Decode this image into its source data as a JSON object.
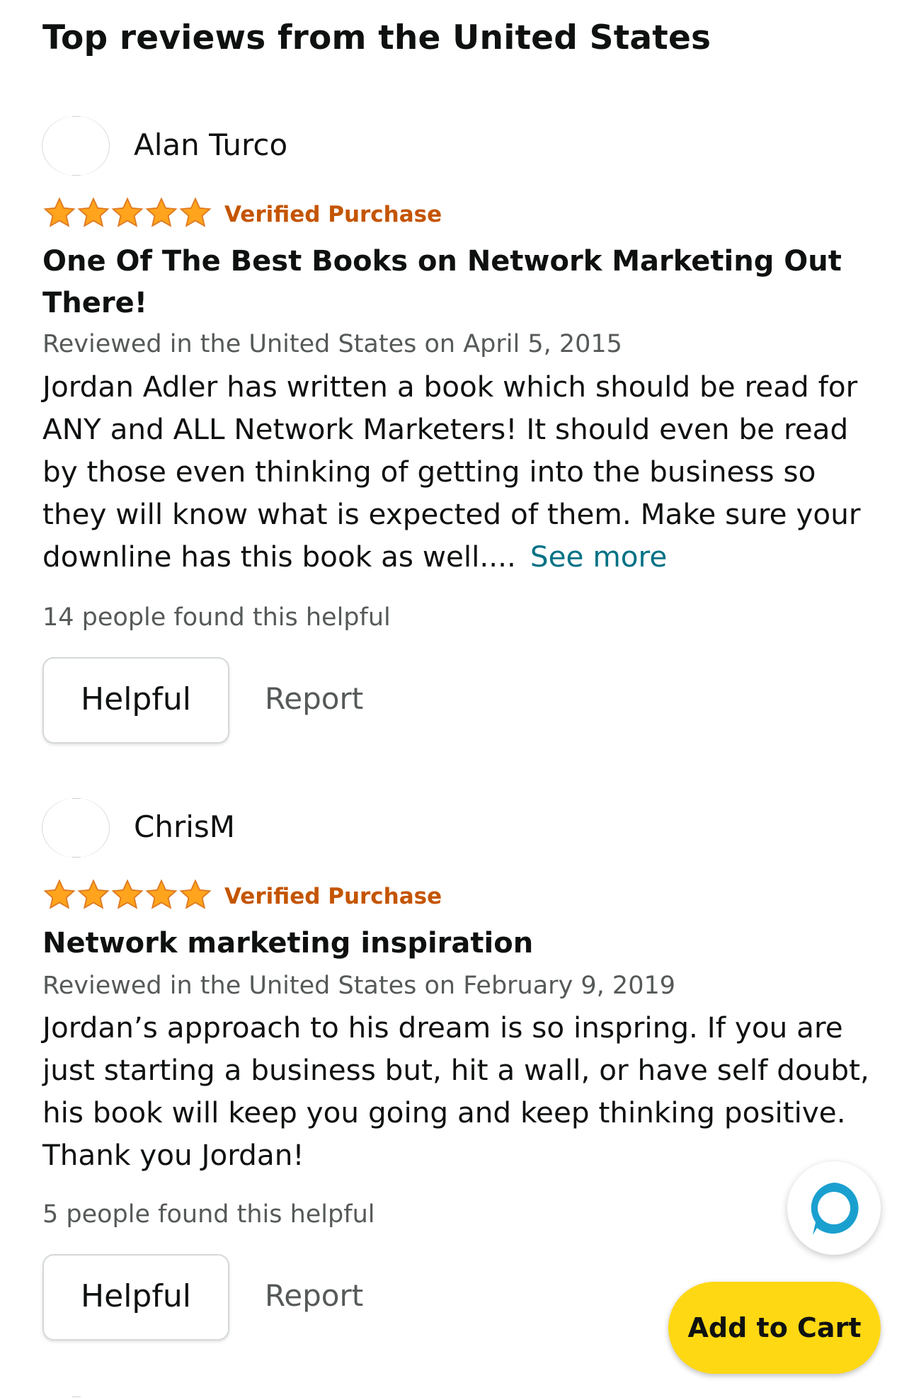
{
  "header": {
    "title": "Top reviews from the United States"
  },
  "colors": {
    "star": "#ffa41c",
    "star_outline": "#de7921",
    "verified": "#c45500",
    "link": "#007185",
    "cart": "#ffd814",
    "alexa_ring": "#1aa0cf"
  },
  "reviews": [
    {
      "reviewer": "Alan Turco",
      "rating": 5,
      "rating_max": 5,
      "verified_label": "Verified Purchase",
      "title": "One Of The Best Books on Network Marketing Out There!",
      "date": "Reviewed in the United States on April 5, 2015",
      "body": "Jordan Adler has written a book which should be read for ANY and ALL Network Marketers! It should even be read by those even thinking of getting into the business so they will know what is expected of them. Make sure your downline has this book as well....",
      "see_more": "See more",
      "helpful_count": "14 people found this helpful",
      "helpful_button": "Helpful",
      "report_link": "Report"
    },
    {
      "reviewer": "ChrisM",
      "rating": 5,
      "rating_max": 5,
      "verified_label": "Verified Purchase",
      "title": "Network marketing inspiration",
      "date": "Reviewed in the United States on February 9, 2019",
      "body": "Jordan’s approach to his dream is so inspring. If you are just starting a business but, hit a wall, or have self doubt, his book will keep you going and keep thinking positive. Thank you Jordan!",
      "helpful_count": "5 people found this helpful",
      "helpful_button": "Helpful",
      "report_link": "Report"
    }
  ],
  "floating": {
    "alexa_icon": "alexa-icon",
    "add_to_cart": "Add to Cart"
  }
}
